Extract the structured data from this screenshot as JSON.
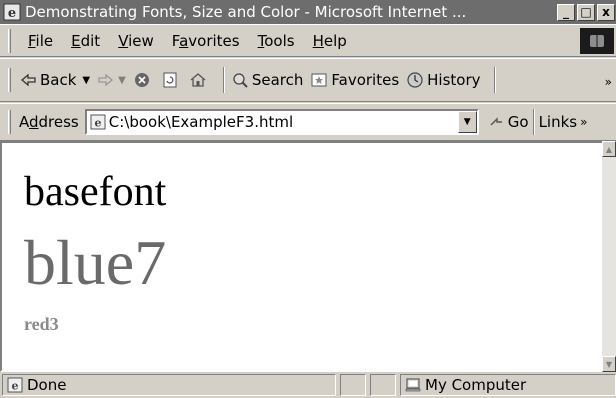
{
  "window": {
    "title": "Demonstrating Fonts, Size and Color - Microsoft Internet ...",
    "controls": {
      "minimize": "_",
      "maximize": "□",
      "close": "x"
    }
  },
  "menu": {
    "items": [
      {
        "label": "File",
        "accel": "F",
        "rest": "ile"
      },
      {
        "label": "Edit",
        "accel": "E",
        "rest": "dit"
      },
      {
        "label": "View",
        "accel": "V",
        "rest": "iew"
      },
      {
        "label": "Favorites",
        "pre": "F",
        "accel": "a",
        "rest": "vorites"
      },
      {
        "label": "Tools",
        "accel": "T",
        "rest": "ools"
      },
      {
        "label": "Help",
        "accel": "H",
        "rest": "elp"
      }
    ]
  },
  "toolbar": {
    "back_label": "Back",
    "search_label": "Search",
    "favorites_label": "Favorites",
    "history_label": "History",
    "more": "»"
  },
  "address": {
    "label_pre": "A",
    "label_accel": "d",
    "label_rest": "dress",
    "url": "C:\\book\\ExampleF3.html",
    "go_label": "Go",
    "links_label": "Links",
    "links_more": "»"
  },
  "content": {
    "line1": "basefont",
    "line2": "blue7",
    "line3": "red3"
  },
  "status": {
    "text": "Done",
    "zone": "My Computer"
  },
  "icons": {
    "browser": "ie-icon",
    "back": "back-arrow-icon",
    "forward": "forward-arrow-icon",
    "stop": "stop-icon",
    "refresh": "refresh-icon",
    "home": "home-icon",
    "search": "search-icon",
    "favorites": "favorites-icon",
    "history": "history-icon",
    "go": "go-arrow-icon",
    "computer": "computer-icon"
  }
}
